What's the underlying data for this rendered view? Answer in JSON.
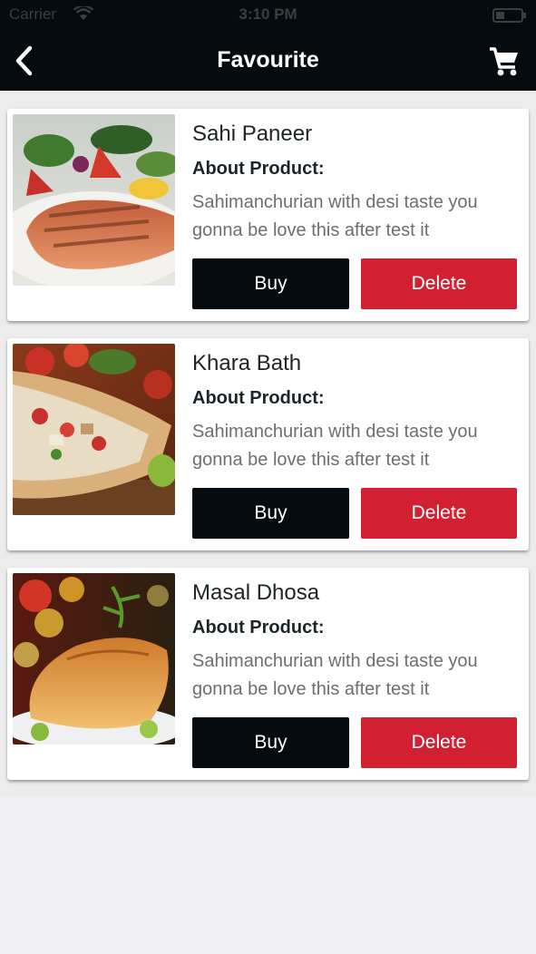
{
  "status": {
    "carrier": "Carrier",
    "time": "3:10 PM"
  },
  "header": {
    "title": "Favourite",
    "back_icon": "chevron-left-icon",
    "cart_icon": "cart-icon"
  },
  "colors": {
    "header_bg": "#050b0e",
    "buy": "#050b0e",
    "delete": "#d21f32",
    "background": "#efeff4"
  },
  "products": [
    {
      "name": "Sahi Paneer",
      "about_label": "About Product:",
      "description": "Sahimanchurian with desi taste you gonna be love this after test it",
      "buy_label": "Buy",
      "delete_label": "Delete"
    },
    {
      "name": "Khara Bath",
      "about_label": "About Product:",
      "description": "Sahimanchurian with desi taste you gonna be love this after test it",
      "buy_label": "Buy",
      "delete_label": "Delete"
    },
    {
      "name": "Masal Dhosa",
      "about_label": "About Product:",
      "description": "Sahimanchurian with desi taste you gonna be love this after test it",
      "buy_label": "Buy",
      "delete_label": "Delete"
    }
  ]
}
